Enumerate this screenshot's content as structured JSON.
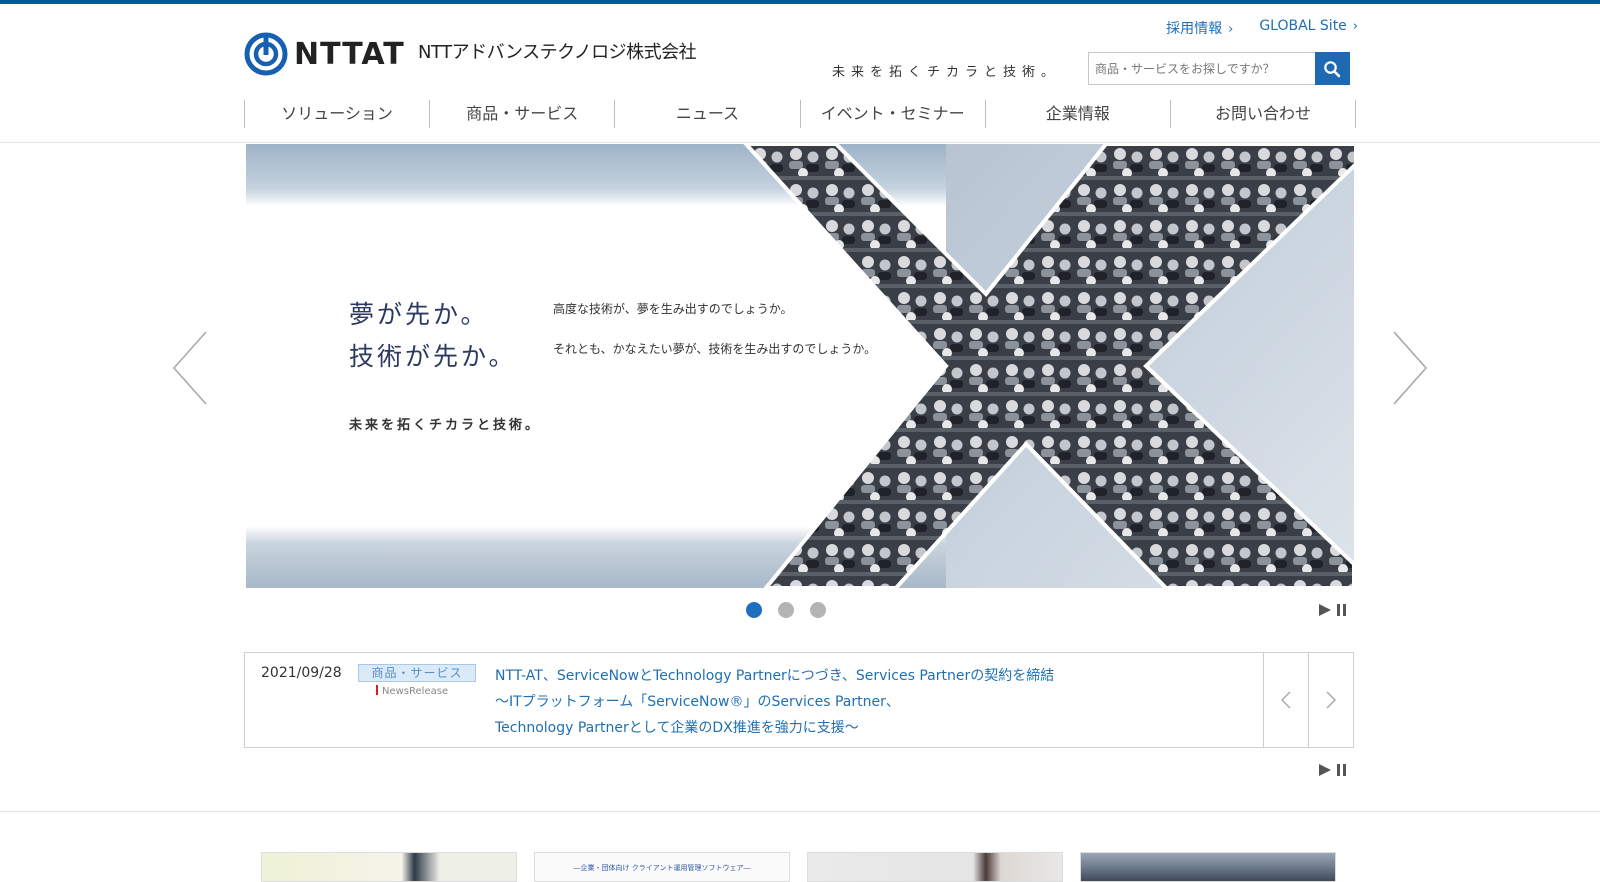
{
  "header": {
    "logo_text": "NTTAT",
    "company_name": "NTTアドバンステクノロジ株式会社",
    "links": [
      {
        "label": "採用情報",
        "chevron": "›"
      },
      {
        "label": "GLOBAL Site",
        "chevron": "›"
      }
    ],
    "tagline": "未来を拓くチカラと技術。",
    "search": {
      "placeholder": "商品・サービスをお探しですか？",
      "icon": "search-icon"
    }
  },
  "nav": {
    "items": [
      {
        "label": "ソリューション"
      },
      {
        "label": "商品・サービス"
      },
      {
        "label": "ニュース"
      },
      {
        "label": "イベント・セミナー"
      },
      {
        "label": "企業情報"
      },
      {
        "label": "お問い合わせ"
      }
    ]
  },
  "hero": {
    "headline_1": "夢が先か。",
    "headline_2": "技術が先か。",
    "sub_1": "高度な技術が、夢を生み出すのでしょうか。",
    "sub_2": "それとも、かなえたい夢が、技術を生み出すのでしょうか。",
    "tagline": "未来を拓くチカラと技術。",
    "slide_count": 3,
    "active_slide": 1
  },
  "news": {
    "date": "2021/09/28",
    "category": "商品・サービス",
    "label": "NewsRelease",
    "title": "NTT-AT、ServiceNowとTechnology Partnerにつづき、Services Partnerの契約を締結",
    "line_2": "～ITプラットフォーム「ServiceNow®」のServices Partner、",
    "line_3": "Technology Partnerとして企業のDX推進を強力に支援～"
  },
  "banners": {
    "b2_caption": "―企業・団体向け クライアント運用管理ソフトウェア―"
  },
  "colors": {
    "brand_blue": "#005a9c",
    "link_blue": "#1f6fb5",
    "active_dot": "#1e6fc0"
  }
}
